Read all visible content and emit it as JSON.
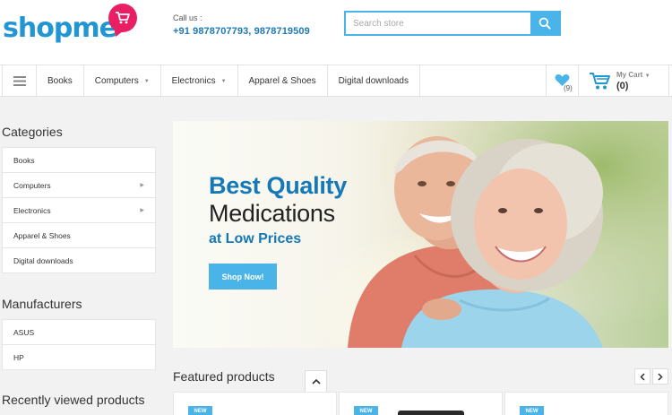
{
  "brand": {
    "logo_part1": "shop",
    "logo_part2": "me"
  },
  "header": {
    "call_label": "Call us :",
    "call_numbers": "+91 9878707793, 9878719509",
    "search_placeholder": "Search store"
  },
  "nav": {
    "items": [
      {
        "label": "Books",
        "has_dropdown": false
      },
      {
        "label": "Computers",
        "has_dropdown": true
      },
      {
        "label": "Electronics",
        "has_dropdown": true
      },
      {
        "label": "Apparel & Shoes",
        "has_dropdown": false
      },
      {
        "label": "Digital downloads",
        "has_dropdown": false
      }
    ],
    "wishlist_count": "(9)",
    "cart_label": "My Cart",
    "cart_count": "(0)"
  },
  "sidebar": {
    "categories_title": "Categories",
    "categories": [
      {
        "label": "Books",
        "has_sub": false
      },
      {
        "label": "Computers",
        "has_sub": true
      },
      {
        "label": "Electronics",
        "has_sub": true
      },
      {
        "label": "Apparel & Shoes",
        "has_sub": false
      },
      {
        "label": "Digital downloads",
        "has_sub": false
      }
    ],
    "manufacturers_title": "Manufacturers",
    "manufacturers": [
      "ASUS",
      "HP"
    ],
    "recent_title": "Recently viewed products"
  },
  "banner": {
    "line1": "Best Quality",
    "line2": "Medications",
    "line3": "at Low Prices",
    "button": "Shop Now!"
  },
  "featured": {
    "title": "Featured products",
    "badge": "NEW"
  },
  "colors": {
    "accent": "#4ab3e8",
    "brand_blue": "#2196d3",
    "brand_pink": "#e91e63",
    "heading_blue": "#1578b7"
  }
}
